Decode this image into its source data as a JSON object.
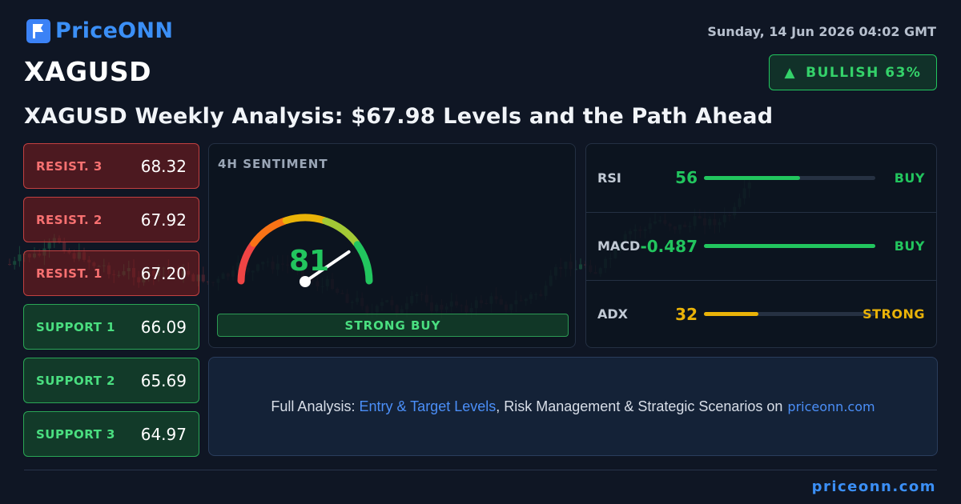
{
  "brand": {
    "name": "PriceONN",
    "logo_icon": "flag-icon"
  },
  "date": "Sunday, 14 Jun 2026 04:02 GMT",
  "ticker": "XAGUSD",
  "sentiment_badge": {
    "label": "BULLISH 63%",
    "icon": "triangle-up-icon",
    "color": "#22c55e"
  },
  "headline": "XAGUSD Weekly Analysis: $67.98 Levels and the Path Ahead",
  "levels": [
    {
      "label": "RESIST. 3",
      "value": "68.32",
      "type": "resistance"
    },
    {
      "label": "RESIST. 2",
      "value": "67.92",
      "type": "resistance"
    },
    {
      "label": "RESIST. 1",
      "value": "67.20",
      "type": "resistance"
    },
    {
      "label": "SUPPORT 1",
      "value": "66.09",
      "type": "support"
    },
    {
      "label": "SUPPORT 2",
      "value": "65.69",
      "type": "support"
    },
    {
      "label": "SUPPORT 3",
      "value": "64.97",
      "type": "support"
    }
  ],
  "sentiment": {
    "title": "4H SENTIMENT",
    "value": "81",
    "score": 81,
    "signal": "STRONG BUY"
  },
  "indicators": [
    {
      "name": "RSI",
      "value": "56",
      "signal": "BUY",
      "level": 0.56,
      "color": "#22c55e"
    },
    {
      "name": "MACD",
      "value": "-0.487",
      "signal": "BUY",
      "level": 1.0,
      "color": "#22c55e"
    },
    {
      "name": "ADX",
      "value": "32",
      "signal": "STRONG",
      "level": 0.32,
      "color": "#eab308"
    }
  ],
  "cta": {
    "prefix": "Full Analysis:",
    "highlight": "Entry & Target Levels",
    "middle": ", Risk Management & Strategic Scenarios on",
    "site": "priceonn.com"
  },
  "footer": {
    "site": "priceonn.com"
  }
}
